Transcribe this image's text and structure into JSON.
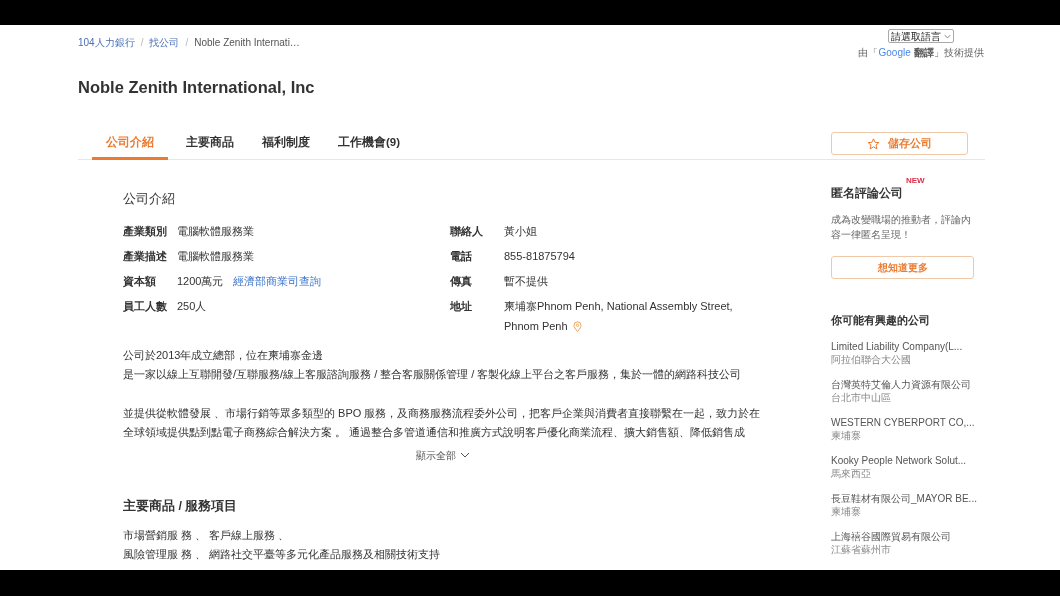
{
  "breadcrumb": [
    {
      "label": "104人力銀行"
    },
    {
      "label": "找公司"
    },
    {
      "label": "Noble Zenith Internati…"
    }
  ],
  "breadcrumb_separator": "/",
  "language_select": {
    "value": "請選取語言"
  },
  "translate_credit": {
    "before": "由「",
    "brand": "Google",
    "service": "翻譯",
    "after": "」技術提供"
  },
  "company_name": "Noble Zenith International, Inc",
  "tabs": [
    {
      "label": "公司介紹",
      "selected": true
    },
    {
      "label": "主要商品",
      "selected": false
    },
    {
      "label": "福利制度",
      "selected": false
    },
    {
      "label": "工作機會(9)",
      "selected": false
    }
  ],
  "save_button": {
    "label": "儲存公司"
  },
  "intro": {
    "title": "公司介紹",
    "left_fields": [
      {
        "label": "產業類別",
        "value": "電腦軟體服務業"
      },
      {
        "label": "產業描述",
        "value": "電腦軟體服務業"
      },
      {
        "label": "資本額",
        "value": "1200萬元",
        "link": "經濟部商業司查詢"
      },
      {
        "label": "員工人數",
        "value": "250人"
      }
    ],
    "right_fields": [
      {
        "label": "聯絡人",
        "value": "黃小姐"
      },
      {
        "label": "電話",
        "value": "855-81875794"
      },
      {
        "label": "傳真",
        "value": "暫不提供"
      },
      {
        "label": "地址",
        "value": "柬埔寨Phnom Penh, National Assembly Street,",
        "value_line_2": "Phnom Penh",
        "map_pin": true
      }
    ],
    "paragraphs": [
      [
        "公司於2013年成立總部，位在柬埔寨金邊",
        "是一家以線上互聯開發/互聯服務/線上客服諮詢服務 / 整合客服關係管理 / 客製化線上平台之客戶服務，集於一體的網路科技公司"
      ],
      [
        "並提供從軟體發展 、市場行銷等眾多類型的 BPO 服務，及商務服務流程委外公司，把客戶企業與消費者直接聯繫在一起，致力於在",
        "全球領域提供點到點電子商務綜合解決方案 。 通過整合多管道通信和推廣方式說明客戶優化商業流程、擴大銷售額、降低銷售成"
      ]
    ],
    "show_all": "顯示全部"
  },
  "products": {
    "title": "主要商品 / 服務項目",
    "lines": [
      "市場營銷服 務 、 客戶線上服務 、",
      "風險管理服 務 、 網路社交平臺等多元化產品服務及相關技術支持"
    ]
  },
  "review": {
    "title": "匿名評論公司",
    "badge": "NEW",
    "text": "成為改變職場的推動者，評論內容一律匿名呈現！",
    "button": "想知道更多"
  },
  "related": {
    "title": "你可能有興趣的公司",
    "items": [
      {
        "name": "Limited Liability Company(L...",
        "location": "阿拉伯聯合大公國"
      },
      {
        "name": "台灣英特艾倫人力資源有限公司",
        "location": "台北市中山區"
      },
      {
        "name": "WESTERN CYBERPORT CO,...",
        "location": "柬埔寨"
      },
      {
        "name": "Kooky People Network Solut...",
        "location": "馬來西亞"
      },
      {
        "name": "長豆鞋材有限公司_MAYOR BE...",
        "location": "柬埔寨"
      },
      {
        "name": "上海禧谷國際貿易有限公司",
        "location": "江蘇省蘇州市"
      }
    ]
  }
}
